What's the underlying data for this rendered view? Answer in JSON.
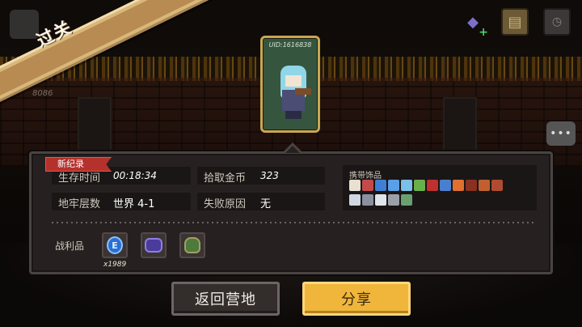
{
  "ribbon": {
    "title": "过关"
  },
  "character_card": {
    "uid": "UID:1616838"
  },
  "panel": {
    "badge": "新纪录",
    "stats": [
      {
        "label": "生存时间",
        "value": "00:18:34"
      },
      {
        "label": "拾取金币",
        "value": "323"
      },
      {
        "label": "地牢层数",
        "value": "世界 4-1"
      },
      {
        "label": "失败原因",
        "value": "无"
      }
    ],
    "accessories": {
      "label": "携带饰品",
      "row1": [
        "#e8e0d0",
        "#c44a4a",
        "#3f7fd6",
        "#5aa0e6",
        "#7ac0e8",
        "#6ab04a",
        "#c03030",
        "#4a7fd0",
        "#e07030",
        "#8a3020",
        "#c06030",
        "#b04a30"
      ],
      "row2": [
        "#cfd8e0",
        "#8a90a0",
        "#dfe5ea",
        "#9aa0a8",
        "#6aa070"
      ]
    },
    "loot": {
      "label": "战利品",
      "items": [
        {
          "name": "energy-coin",
          "count": "x1989"
        },
        {
          "name": "potion"
        },
        {
          "name": "seed-bag"
        }
      ]
    }
  },
  "buttons": {
    "camp": "返回营地",
    "share": "分享"
  },
  "background": {
    "score_text": "8086"
  },
  "icons": {
    "gem": "gem-icon",
    "chest": "chest-icon",
    "calendar": "calendar-icon",
    "chat": "chat-icon"
  },
  "colors": {
    "share": "#f0b63b",
    "record": "#b5312b",
    "card": "#36553f"
  }
}
